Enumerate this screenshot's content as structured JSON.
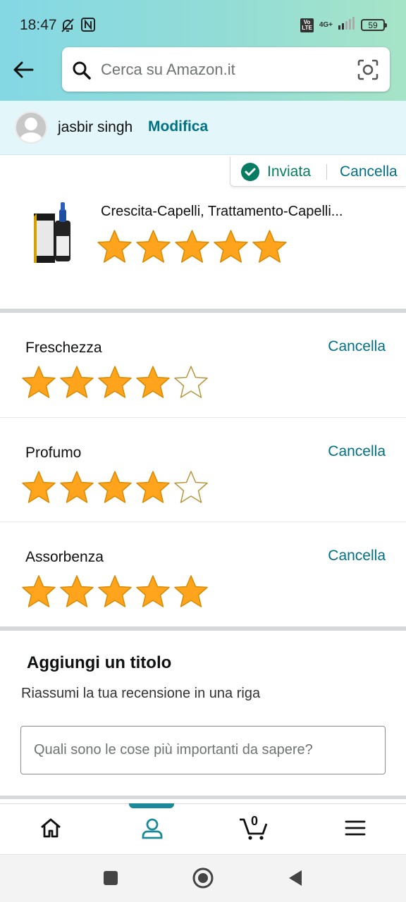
{
  "status_bar": {
    "time": "18:47",
    "network": "4G+",
    "battery": "59"
  },
  "search": {
    "placeholder": "Cerca su Amazon.it"
  },
  "user": {
    "name": "jasbir singh",
    "edit_label": "Modifica"
  },
  "submission": {
    "status": "Inviata",
    "cancel_label": "Cancella"
  },
  "product": {
    "title": "Crescita-Capelli, Trattamento-Capelli...",
    "rating": 5,
    "rating_max": 5
  },
  "attributes": [
    {
      "label": "Freschezza",
      "cancel_label": "Cancella",
      "rating": 4,
      "rating_max": 5
    },
    {
      "label": "Profumo",
      "cancel_label": "Cancella",
      "rating": 4,
      "rating_max": 5
    },
    {
      "label": "Assorbenza",
      "cancel_label": "Cancella",
      "rating": 5,
      "rating_max": 5
    }
  ],
  "title_section": {
    "heading": "Aggiungi un titolo",
    "subtitle": "Riassumi la tua recensione in una riga",
    "placeholder": "Quali sono le cose più importanti da sapere?"
  },
  "bottom_tabs": {
    "items": [
      "home-icon",
      "account-icon",
      "cart-icon",
      "menu-icon"
    ],
    "active": "account-icon",
    "cart_count": "0"
  },
  "colors": {
    "accent": "#007185",
    "star": "#ffa41c",
    "success": "#067d62"
  }
}
